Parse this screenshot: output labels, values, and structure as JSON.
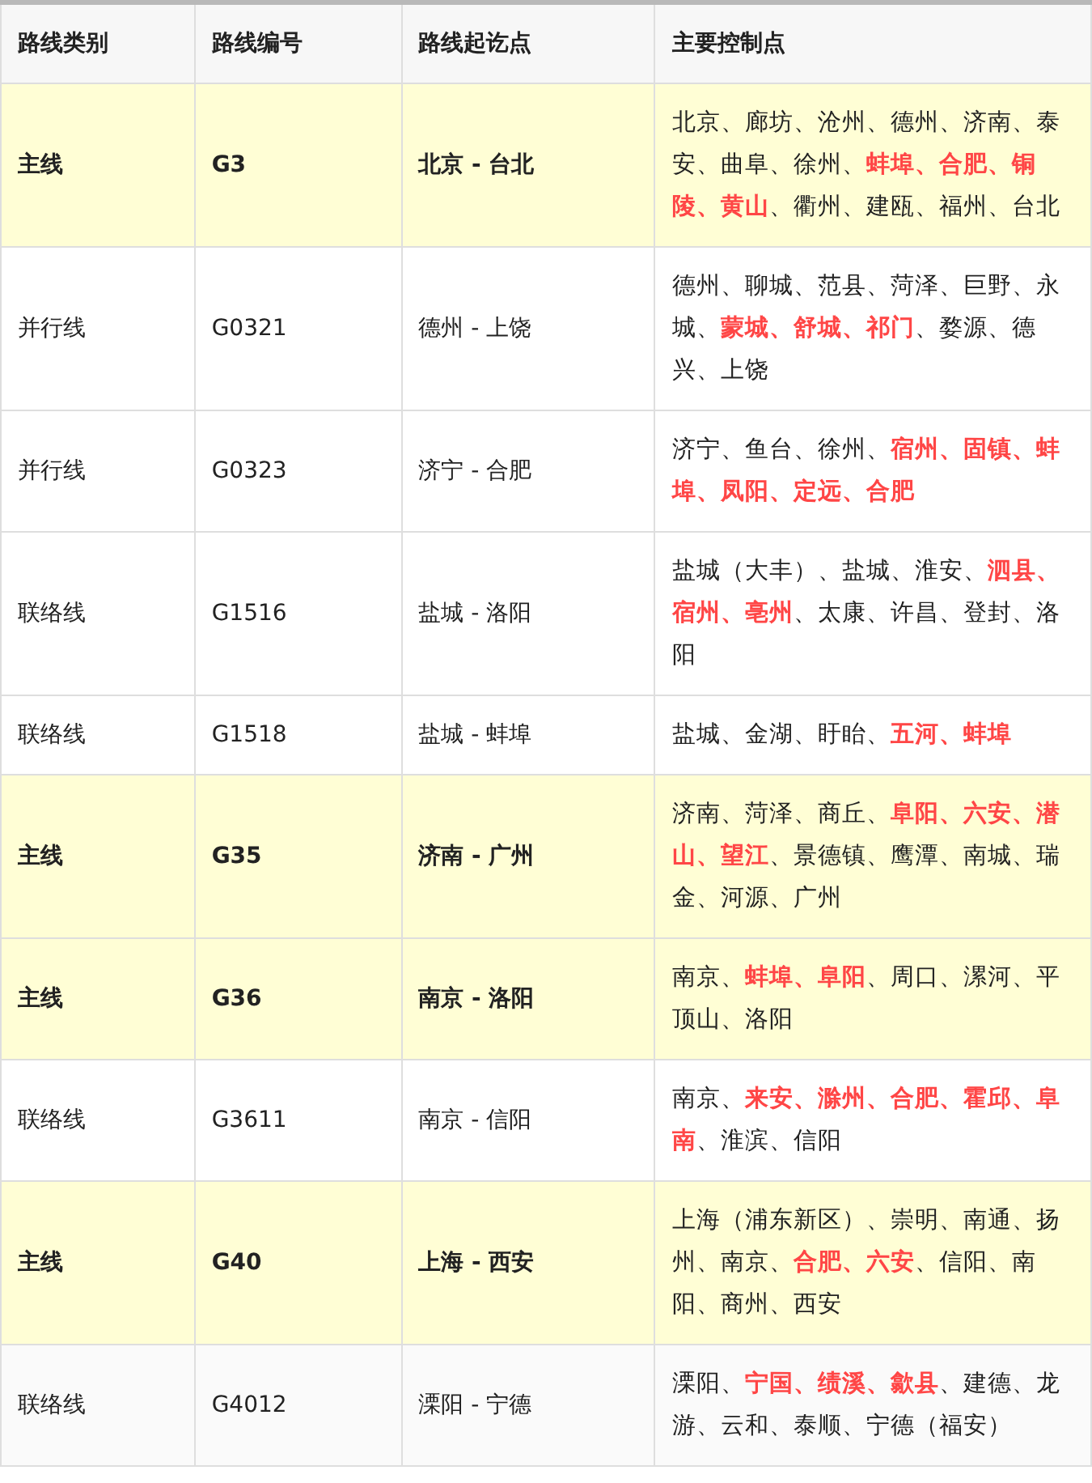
{
  "table": {
    "columns": [
      "路线类别",
      "路线编号",
      "路线起讫点",
      "主要控制点"
    ],
    "rows": [
      {
        "kind": "main",
        "hovered": false,
        "category": "主线",
        "code": "G3",
        "endpoints": "北京 - 台北",
        "control_points": "北京、廊坊、沧州、德州、济南、泰安、曲阜、徐州、**蚌埠、合肥、铜陵、黄山**、衢州、建瓯、福州、台北"
      },
      {
        "kind": "parallel",
        "hovered": false,
        "category": "并行线",
        "code": "G0321",
        "endpoints": "德州 - 上饶",
        "control_points": "德州、聊城、范县、菏泽、巨野、永城、**蒙城、舒城、祁门**、婺源、德兴、上饶"
      },
      {
        "kind": "parallel",
        "hovered": false,
        "category": "并行线",
        "code": "G0323",
        "endpoints": "济宁 - 合肥",
        "control_points": "济宁、鱼台、徐州、**宿州、固镇、蚌埠、凤阳、定远、合肥**"
      },
      {
        "kind": "link",
        "hovered": false,
        "category": "联络线",
        "code": "G1516",
        "endpoints": "盐城 - 洛阳",
        "control_points": "盐城（大丰）、盐城、淮安、**泗县、宿州、亳州**、太康、许昌、登封、洛阳"
      },
      {
        "kind": "link",
        "hovered": false,
        "category": "联络线",
        "code": "G1518",
        "endpoints": "盐城 - 蚌埠",
        "control_points": "盐城、金湖、盱眙、**五河、蚌埠**"
      },
      {
        "kind": "main",
        "hovered": false,
        "category": "主线",
        "code": "G35",
        "endpoints": "济南 - 广州",
        "control_points": "济南、菏泽、商丘、**阜阳、六安、潜山、望江**、景德镇、鹰潭、南城、瑞金、河源、广州"
      },
      {
        "kind": "main",
        "hovered": false,
        "category": "主线",
        "code": "G36",
        "endpoints": "南京 - 洛阳",
        "control_points": "南京、**蚌埠、阜阳**、周口、漯河、平顶山、洛阳"
      },
      {
        "kind": "link",
        "hovered": false,
        "category": "联络线",
        "code": "G3611",
        "endpoints": "南京 - 信阳",
        "control_points": "南京、**来安、滁州、合肥、霍邱、阜南**、淮滨、信阳"
      },
      {
        "kind": "main",
        "hovered": false,
        "category": "主线",
        "code": "G40",
        "endpoints": "上海 - 西安",
        "control_points": "上海（浦东新区）、崇明、南通、扬州、南京、**合肥、六安**、信阳、南阳、商州、西安"
      },
      {
        "kind": "link",
        "hovered": true,
        "category": "联络线",
        "code": "G4012",
        "endpoints": "溧阳 - 宁德",
        "control_points": "溧阳、**宁国、绩溪、歙县**、建德、龙游、云和、泰顺、宁德（福安）"
      }
    ]
  }
}
